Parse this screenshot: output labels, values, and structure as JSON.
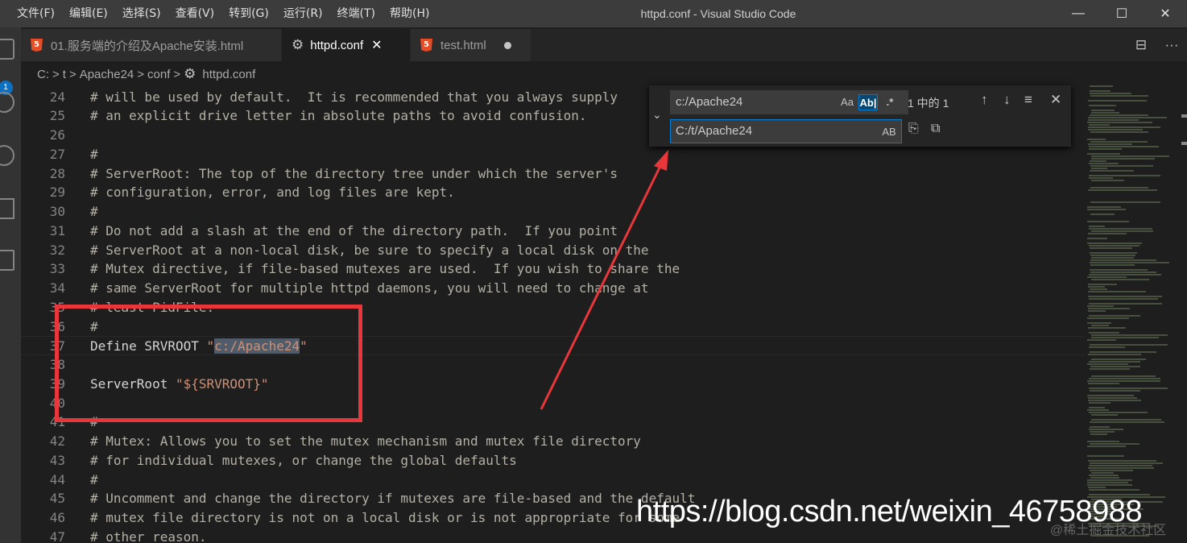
{
  "window": {
    "title": "httpd.conf - Visual Studio Code",
    "menu": [
      "文件(F)",
      "编辑(E)",
      "选择(S)",
      "查看(V)",
      "转到(G)",
      "运行(R)",
      "终端(T)",
      "帮助(H)"
    ],
    "controls": [
      "—",
      "☐",
      "✕"
    ]
  },
  "activity": {
    "badge": "1"
  },
  "tabs": [
    {
      "label": "01.服务端的介绍及Apache安装.html",
      "icon": "html5-icon",
      "badge": "5"
    },
    {
      "label": "httpd.conf",
      "icon": "gear-icon",
      "close": "✕"
    },
    {
      "label": "test.html",
      "icon": "html5-icon",
      "badge": "5"
    }
  ],
  "tab_actions": {
    "split": "⊟",
    "more": "···"
  },
  "breadcrumb": [
    "C:",
    "t",
    "Apache24",
    "conf",
    "httpd.conf"
  ],
  "breadcrumb_sep": ">",
  "editor": {
    "lines": [
      {
        "n": "24",
        "t": "# will be used by default.  It is recommended that you always supply"
      },
      {
        "n": "25",
        "t": "# an explicit drive letter in absolute paths to avoid confusion."
      },
      {
        "n": "26",
        "t": ""
      },
      {
        "n": "27",
        "t": "#"
      },
      {
        "n": "28",
        "t": "# ServerRoot: The top of the directory tree under which the server's"
      },
      {
        "n": "29",
        "t": "# configuration, error, and log files are kept."
      },
      {
        "n": "30",
        "t": "#"
      },
      {
        "n": "31",
        "t": "# Do not add a slash at the end of the directory path.  If you point"
      },
      {
        "n": "32",
        "t": "# ServerRoot at a non-local disk, be sure to specify a local disk on the"
      },
      {
        "n": "33",
        "t": "# Mutex directive, if file-based mutexes are used.  If you wish to share the"
      },
      {
        "n": "34",
        "t": "# same ServerRoot for multiple httpd daemons, you will need to change at"
      },
      {
        "n": "35",
        "t": "# least PidFile."
      },
      {
        "n": "36",
        "t": "#"
      },
      {
        "n": "37",
        "t": ""
      },
      {
        "n": "38",
        "t": ""
      },
      {
        "n": "39",
        "t": ""
      },
      {
        "n": "40",
        "t": ""
      },
      {
        "n": "41",
        "t": "#"
      },
      {
        "n": "42",
        "t": "# Mutex: Allows you to set the mutex mechanism and mutex file directory"
      },
      {
        "n": "43",
        "t": "# for individual mutexes, or change the global defaults"
      },
      {
        "n": "44",
        "t": "#"
      },
      {
        "n": "45",
        "t": "# Uncomment and change the directory if mutexes are file-based and the default"
      },
      {
        "n": "46",
        "t": "# mutex file directory is not on a local disk or is not appropriate for some"
      },
      {
        "n": "47",
        "t": "# other reason."
      }
    ],
    "define": {
      "keyword": "Define SRVROOT ",
      "quote_open": "\"",
      "match": "c:/Apache24",
      "quote_close": "\""
    },
    "serverroot": {
      "keyword": "ServerRoot ",
      "value": "\"${SRVROOT}\""
    }
  },
  "find_widget": {
    "find_value": "c:/Apache24",
    "replace_value": "C:/t/Apache24",
    "match_case": "Aa",
    "whole_word": "Ab|",
    "regex": ".*",
    "preserve_case": "AB",
    "count": "1 中的 1",
    "prev": "↑",
    "next": "↓",
    "selection": "≡",
    "close": "✕",
    "toggle": "⌄"
  },
  "watermark": {
    "url": "https://blog.csdn.net/weixin_46758988",
    "sub": "@稀土掘金技术社区"
  }
}
